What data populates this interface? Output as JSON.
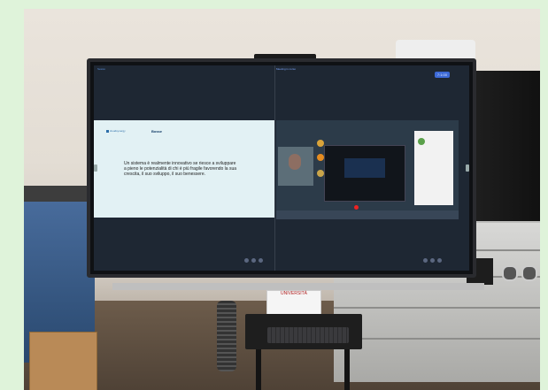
{
  "screen": {
    "top_left_label": "Sessio",
    "top_center_label": "Meeting in corso",
    "tag": "7:1:00",
    "slide": {
      "logo_text": "cloudsynergy",
      "brand_text": "Bosse",
      "body_text": "Un sistema è realmente innovativo se riesce a sviluppare a pieno le potenzialità di chi è più fragile favorendo la sua crescita, il suo sviluppo, il suo benessere."
    }
  },
  "sign": {
    "text": "UNIVERSITÀ"
  },
  "colors": {
    "background": "#dff3da",
    "slide_bg": "#e2f1f4",
    "screen_bg": "#1e2733",
    "accent_blue": "#3d6ad6"
  }
}
